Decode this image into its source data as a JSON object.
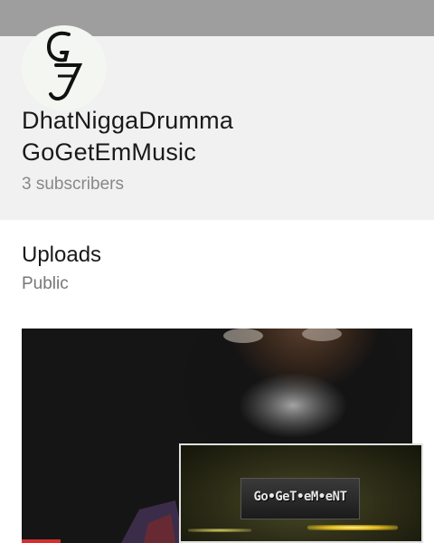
{
  "channel": {
    "logo_text": "Gg",
    "name_line1": "DhatNiggaDrumma",
    "name_line2": "GoGetEmMusic",
    "subscribers": "3 subscribers"
  },
  "uploads": {
    "title": "Uploads",
    "visibility": "Public"
  },
  "video": {
    "thumbnail_icon": "video-thumbnail",
    "overlay_logo_text": "Go•GeT•eM•eNT",
    "progress": 0.1
  },
  "colors": {
    "banner": "#9e9e9e",
    "header_bg": "#f1f1f1",
    "progress": "#d32f2f"
  }
}
